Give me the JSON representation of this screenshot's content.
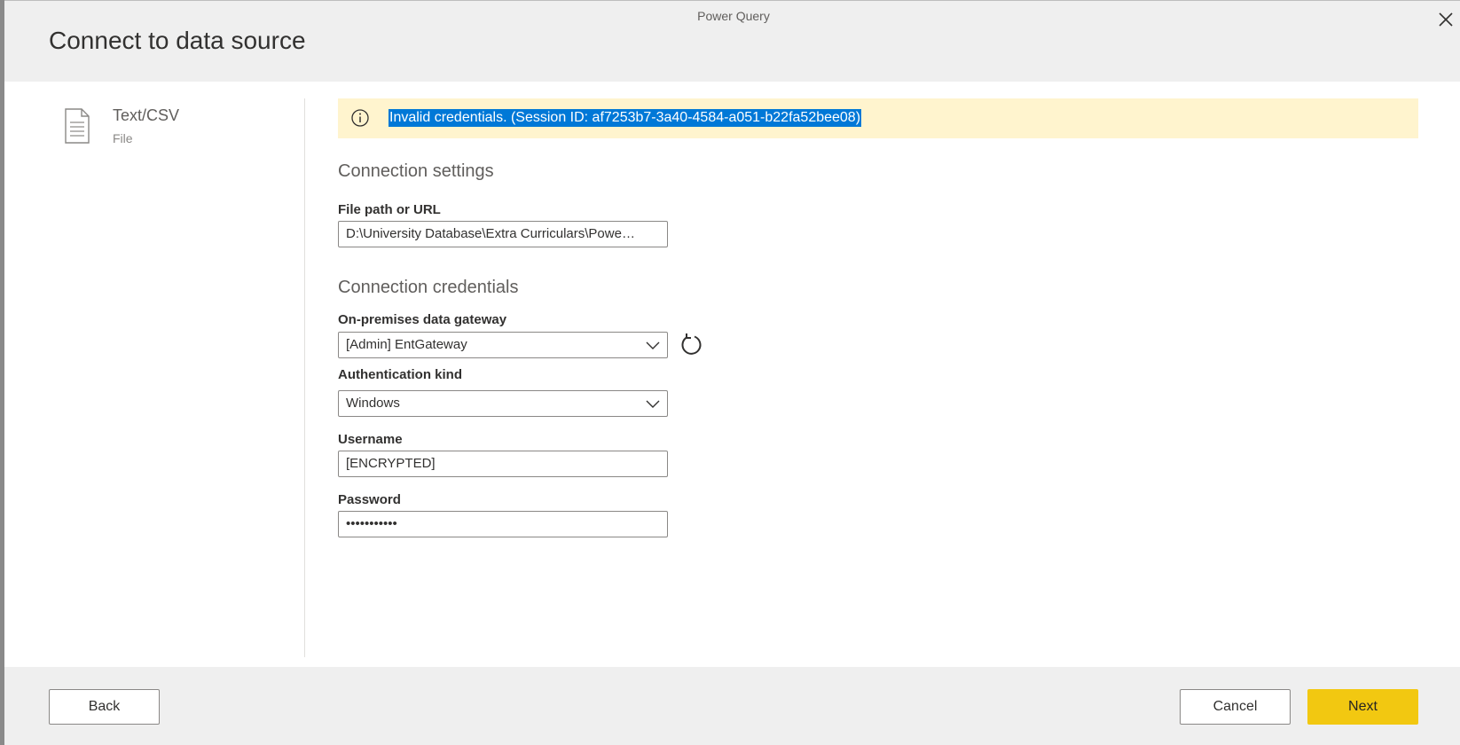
{
  "window": {
    "app_title": "Power Query"
  },
  "header": {
    "title": "Connect to data source"
  },
  "connector": {
    "name": "Text/CSV",
    "category": "File",
    "icon": "document-icon"
  },
  "banner": {
    "message": "Invalid credentials. (Session ID: af7253b7-3a40-4584-a051-b22fa52bee08)",
    "icon": "info-icon"
  },
  "connection_settings": {
    "title": "Connection settings",
    "file_path_label": "File path or URL",
    "file_path_value": "D:\\University Database\\Extra Curriculars\\Power ..."
  },
  "connection_credentials": {
    "title": "Connection credentials",
    "gateway_label": "On-premises data gateway",
    "gateway_value": "[Admin] EntGateway",
    "auth_label": "Authentication kind",
    "auth_value": "Windows",
    "username_label": "Username",
    "username_value": "[ENCRYPTED]",
    "password_label": "Password",
    "password_value": "•••••••••••"
  },
  "footer": {
    "back_label": "Back",
    "cancel_label": "Cancel",
    "next_label": "Next"
  },
  "colors": {
    "accent": "#f2c811",
    "warning_bg": "#fff4ce",
    "selection": "#0078d7"
  }
}
